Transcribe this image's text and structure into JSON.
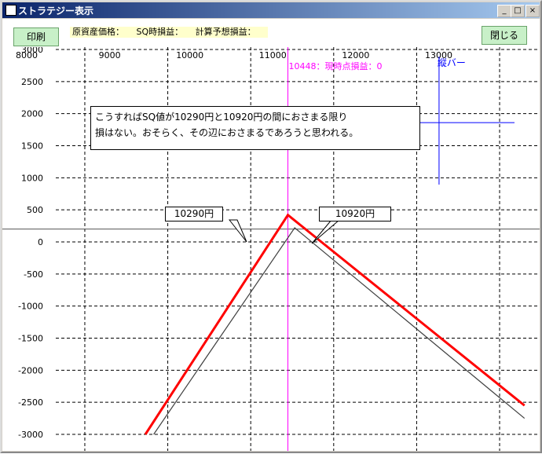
{
  "window": {
    "title": "ストラテジー表示"
  },
  "titlebar_buttons": {
    "minimize": "_",
    "maximize": "□",
    "close": "×"
  },
  "toolbar": {
    "print_label": "印刷",
    "close_label": "閉じる",
    "underlying_price_label": "原資産価格：",
    "sq_pnl_label": "SQ時損益：",
    "calc_expected_pnl_label": "計算予想損益："
  },
  "chart_data": {
    "type": "line",
    "x_ticks": [
      8000,
      9000,
      10000,
      11000,
      12000,
      13000
    ],
    "y_ticks": [
      3000,
      2500,
      2000,
      1500,
      1000,
      500,
      0,
      -500,
      -1000,
      -1500,
      -2000,
      -2500,
      -3000
    ],
    "x_tick_labels": [
      "8000",
      "9000",
      "10000",
      "11000",
      "12000",
      "13000"
    ],
    "y_tick_labels": [
      "3000",
      "2500",
      "2000",
      "1500",
      "1000",
      "500",
      "0",
      "-500",
      "-1000",
      "-1500",
      "-2000",
      "-2500",
      "-3000"
    ],
    "xlim": [
      7650,
      13350
    ],
    "ylim": [
      -3000,
      3000
    ],
    "grid": true,
    "zero_line_value": 200,
    "current_price": 10448,
    "current_label": "10448：現時点損益：0",
    "vertical_bar_label": "縦バー",
    "vertical_bar_x": 12270,
    "crosshair_y": 1860,
    "series": [
      {
        "color": "#ff0000",
        "x": [
          8730,
          10448,
          13300
        ],
        "y": [
          -3000,
          420,
          -2550
        ]
      },
      {
        "color": "#404040",
        "x": [
          8830,
          10530,
          13300
        ],
        "y": [
          -3000,
          220,
          -2750
        ]
      }
    ]
  },
  "annotations": {
    "main_note": "こうすればSQ値が10290円と10920円の間におさまる限り\n損はない。おそらく、その辺におさまるであろうと思われる。",
    "break_even_low": "10290円",
    "break_even_high": "10920円"
  },
  "colors": {
    "titlebar_start": "#0a246a",
    "titlebar_end": "#a6caf0",
    "button_bg": "#c8f0c8",
    "info_bg": "#ffffcc",
    "current_line": "#ff00ff",
    "vertical_bar": "#0000ff",
    "pnl_sq": "#ff0000",
    "pnl_calc": "#404040"
  }
}
